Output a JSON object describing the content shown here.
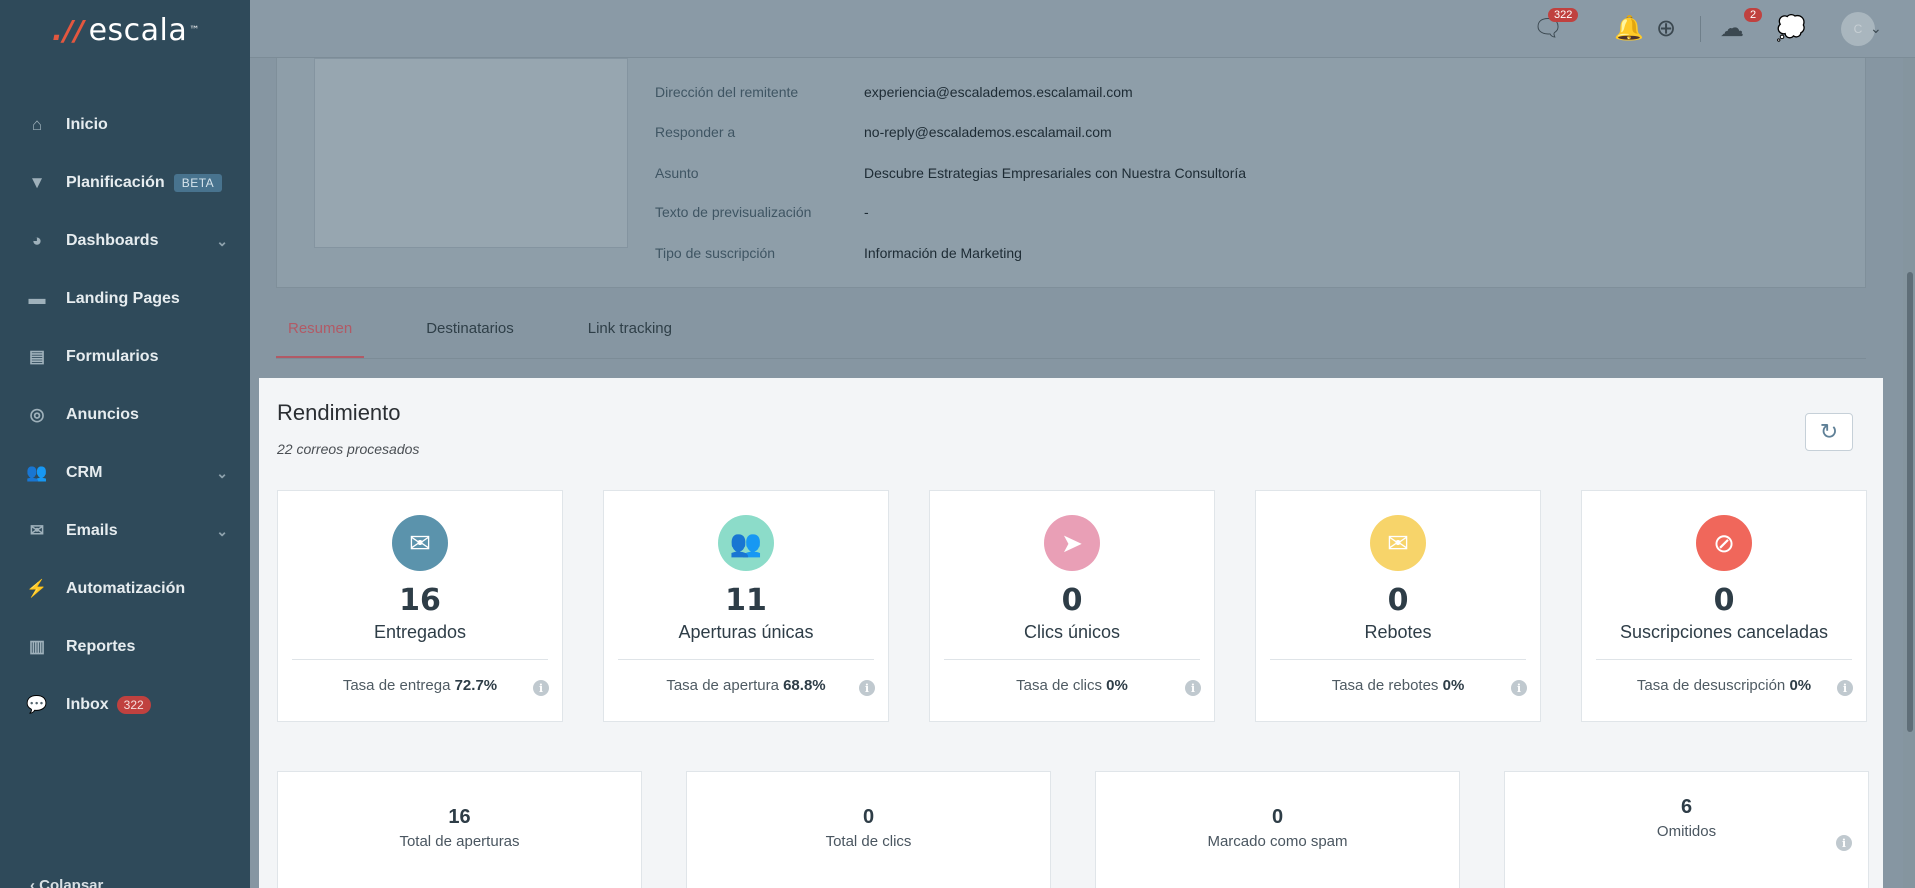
{
  "brand": {
    "name": "escala",
    "mark": ".//",
    "tm": "™"
  },
  "sidebar": {
    "items": [
      {
        "label": "Inicio",
        "icon": "home-icon"
      },
      {
        "label": "Planificación",
        "badge": "BETA",
        "icon": "filter-icon"
      },
      {
        "label": "Dashboards",
        "icon": "pie-chart-icon",
        "has_submenu": true
      },
      {
        "label": "Landing Pages",
        "icon": "page-icon"
      },
      {
        "label": "Formularios",
        "icon": "form-icon"
      },
      {
        "label": "Anuncios",
        "icon": "target-icon"
      },
      {
        "label": "CRM",
        "icon": "users-icon",
        "has_submenu": true
      },
      {
        "label": "Emails",
        "icon": "envelope-icon",
        "has_submenu": true
      },
      {
        "label": "Automatización",
        "icon": "bolt-icon"
      },
      {
        "label": "Reportes",
        "icon": "bar-chart-icon"
      },
      {
        "label": "Inbox",
        "badge": "322",
        "icon": "chat-icon"
      }
    ],
    "footer_label": "Colapsar"
  },
  "topbar": {
    "chat_badge": "322",
    "support_badge": "2",
    "avatar_initial": "C"
  },
  "details": {
    "rows": [
      {
        "label": "Dirección del remitente",
        "value": "experiencia@escalademos.escalamail.com"
      },
      {
        "label": "Responder a",
        "value": "no-reply@escalademos.escalamail.com"
      },
      {
        "label": "Asunto",
        "value": "Descubre Estrategias Empresariales con Nuestra Consultoría"
      },
      {
        "label": "Texto de previsualización",
        "value": "-"
      },
      {
        "label": "Tipo de suscripción",
        "value": "Información de Marketing"
      }
    ]
  },
  "tabs": [
    "Resumen",
    "Destinatarios",
    "Link tracking"
  ],
  "performance": {
    "title": "Rendimiento",
    "subtitle": "22 correos procesados",
    "stats": [
      {
        "value": "16",
        "label": "Entregados",
        "rate_label": "Tasa de entrega",
        "rate": "72.7%",
        "icon": "envelope-check-icon",
        "color": "#5b93ac"
      },
      {
        "value": "11",
        "label": "Aperturas únicas",
        "rate_label": "Tasa de apertura",
        "rate": "68.8%",
        "icon": "users-check-icon",
        "color": "#8cdcc9"
      },
      {
        "value": "0",
        "label": "Clics únicos",
        "rate_label": "Tasa de clics",
        "rate": "0%",
        "icon": "cursor-icon",
        "color": "#e99fb6"
      },
      {
        "value": "0",
        "label": "Rebotes",
        "rate_label": "Tasa de rebotes",
        "rate": "0%",
        "icon": "envelope-x-icon",
        "color": "#f7d46a"
      },
      {
        "value": "0",
        "label": "Suscripciones canceladas",
        "rate_label": "Tasa de desuscripción",
        "rate": "0%",
        "icon": "ban-icon",
        "color": "#f0675b"
      }
    ],
    "totals": [
      {
        "value": "16",
        "label": "Total de aperturas"
      },
      {
        "value": "0",
        "label": "Total de clics"
      },
      {
        "value": "0",
        "label": "Marcado como spam"
      },
      {
        "value": "6",
        "label": "Omitidos"
      }
    ]
  }
}
